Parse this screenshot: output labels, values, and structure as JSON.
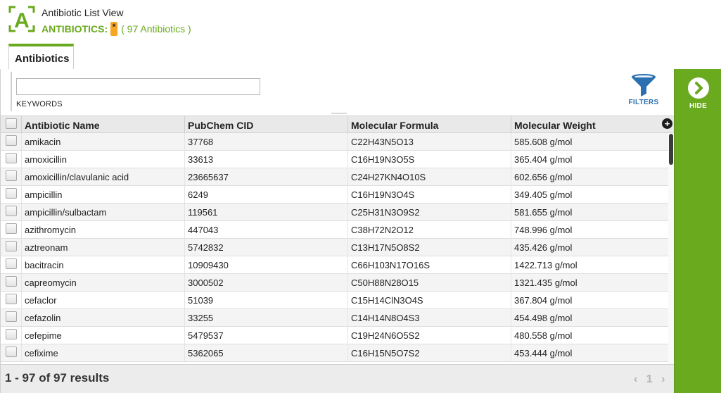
{
  "header": {
    "view_title": "Antibiotic List View",
    "section_label": "ANTIBIOTICS:",
    "filter_badge": "*",
    "count_text": "( 97 Antibiotics )",
    "logo_letter": "A"
  },
  "tabs": [
    {
      "label": "Antibiotics"
    }
  ],
  "filter_bar": {
    "keywords_value": "",
    "keywords_label": "KEYWORDS",
    "filters_label": "FILTERS"
  },
  "table": {
    "columns": [
      "Antibiotic Name",
      "PubChem CID",
      "Molecular Formula",
      "Molecular Weight"
    ],
    "rows": [
      [
        "amikacin",
        "37768",
        "C22H43N5O13",
        "585.608 g/mol"
      ],
      [
        "amoxicillin",
        "33613",
        "C16H19N3O5S",
        "365.404 g/mol"
      ],
      [
        "amoxicillin/clavulanic acid",
        "23665637",
        "C24H27KN4O10S",
        "602.656 g/mol"
      ],
      [
        "ampicillin",
        "6249",
        "C16H19N3O4S",
        "349.405 g/mol"
      ],
      [
        "ampicillin/sulbactam",
        "119561",
        "C25H31N3O9S2",
        "581.655 g/mol"
      ],
      [
        "azithromycin",
        "447043",
        "C38H72N2O12",
        "748.996 g/mol"
      ],
      [
        "aztreonam",
        "5742832",
        "C13H17N5O8S2",
        "435.426 g/mol"
      ],
      [
        "bacitracin",
        "10909430",
        "C66H103N17O16S",
        "1422.713 g/mol"
      ],
      [
        "capreomycin",
        "3000502",
        "C50H88N28O15",
        "1321.435 g/mol"
      ],
      [
        "cefaclor",
        "51039",
        "C15H14ClN3O4S",
        "367.804 g/mol"
      ],
      [
        "cefazolin",
        "33255",
        "C14H14N8O4S3",
        "454.498 g/mol"
      ],
      [
        "cefepime",
        "5479537",
        "C19H24N6O5S2",
        "480.558 g/mol"
      ],
      [
        "cefixime",
        "5362065",
        "C16H15N5O7S2",
        "453.444 g/mol"
      ]
    ]
  },
  "footer": {
    "results_text": "1 - 97 of 97 results",
    "page_prev": "‹",
    "page_number": "1",
    "page_next": "›"
  },
  "side_panel": {
    "hide_label": "HIDE"
  },
  "colors": {
    "brand_green": "#6aaa1e",
    "badge_orange": "#f5a623",
    "link_blue": "#2a6fb0"
  }
}
